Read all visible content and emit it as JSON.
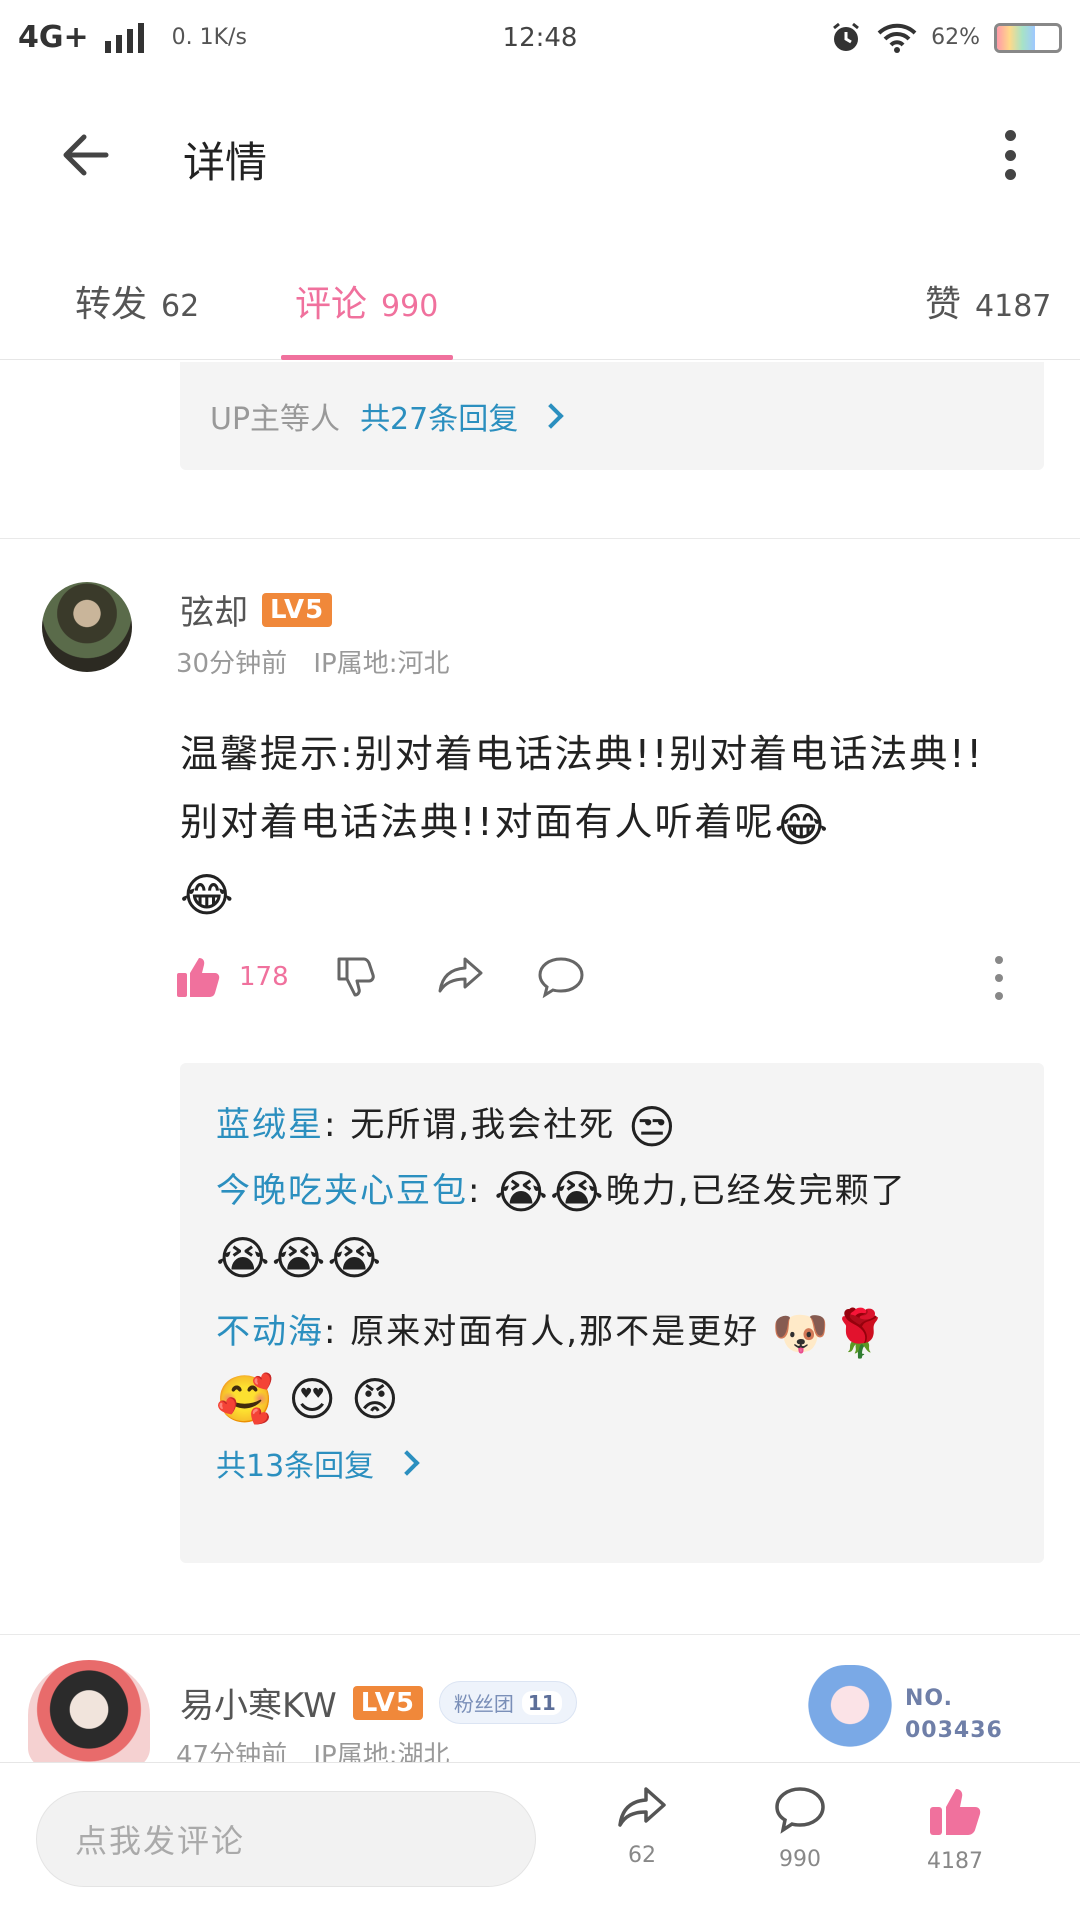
{
  "status_bar": {
    "network": "4G+",
    "speed": "0. 1K/s",
    "time": "12:48",
    "battery_text": "62%",
    "battery_level": 0.62
  },
  "header": {
    "title": "详情"
  },
  "tabs": [
    {
      "label": "转发",
      "count": "62"
    },
    {
      "label": "评论",
      "count": "990"
    },
    {
      "label": "赞",
      "count": "4187"
    }
  ],
  "first_reply_box": {
    "text": "UP主等人",
    "count_link": "共27条回复"
  },
  "comment": {
    "username": "弦却",
    "level": "LV5",
    "time": "30分钟前",
    "ip": "IP属地:河北",
    "text": "温馨提示:别对着电话法典!!别对着电话法典!!别对着电话法典!!对面有人听着呢",
    "like_count": "178"
  },
  "replies": [
    {
      "name": "蓝绒星",
      "text": "无所谓,我会社死"
    },
    {
      "name": "今晚吃夹心豆包",
      "text": "晚力,已经发完颗了"
    },
    {
      "name": "不动海",
      "text": "原来对面有人,那不是更好"
    }
  ],
  "replies_count": "共13条回复",
  "comment2": {
    "username": "易小寒KW",
    "level": "LV5",
    "fan_label": "粉丝团",
    "fan_level": "11",
    "time": "47分钟前",
    "ip": "IP属地:湖北",
    "badge_line1": "NO.",
    "badge_line2": "003436"
  },
  "bottom_bar": {
    "input_placeholder": "点我发评论",
    "share_count": "62",
    "comment_count": "990",
    "like_count": "4187"
  },
  "colors": {
    "accent_pink": "#f0719d",
    "link_blue": "#2b8fbf",
    "level_orange": "#f0883a"
  }
}
